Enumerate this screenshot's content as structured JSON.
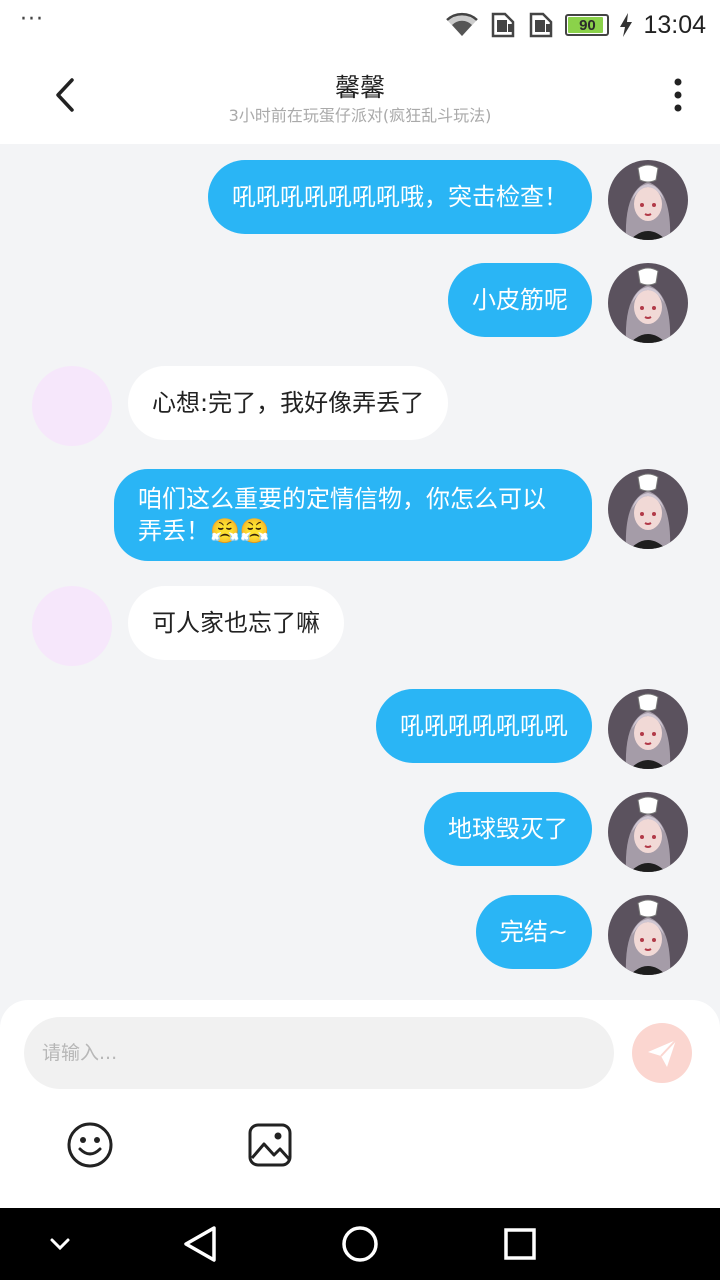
{
  "status_bar": {
    "time": "13:04",
    "battery": "90",
    "battery_level": 0.9,
    "icons": [
      "more-dots-icon",
      "wifi-icon",
      "sim1-icon",
      "sim2-icon",
      "battery-icon",
      "charging-icon"
    ]
  },
  "header": {
    "title": "馨馨",
    "subtitle": "3小时前在玩蛋仔派对(疯狂乱斗玩法)",
    "back_icon": "chevron-left-icon",
    "menu_icon": "more-vertical-icon"
  },
  "messages": [
    {
      "side": "out",
      "text": "吼吼吼吼吼吼吼哦，突击检查！"
    },
    {
      "side": "out",
      "text": "小皮筋呢"
    },
    {
      "side": "in",
      "text": "心想:完了，我好像弄丢了"
    },
    {
      "side": "out",
      "text": "咱们这么重要的定情信物，你怎么可以弄丢！😤😤"
    },
    {
      "side": "in",
      "text": "可人家也忘了嘛"
    },
    {
      "side": "out",
      "text": "吼吼吼吼吼吼吼"
    },
    {
      "side": "out",
      "text": "地球毁灭了"
    },
    {
      "side": "out",
      "text": "完结~"
    }
  ],
  "composer": {
    "placeholder": "请输入...",
    "send_icon": "paper-plane-icon",
    "emoji_icon": "smiley-icon",
    "image_icon": "image-icon"
  },
  "colors": {
    "outgoing_bubble": "#2ab5f5",
    "incoming_bubble": "#ffffff",
    "background": "#f3f4f6",
    "send_button": "#fbd6d0"
  }
}
